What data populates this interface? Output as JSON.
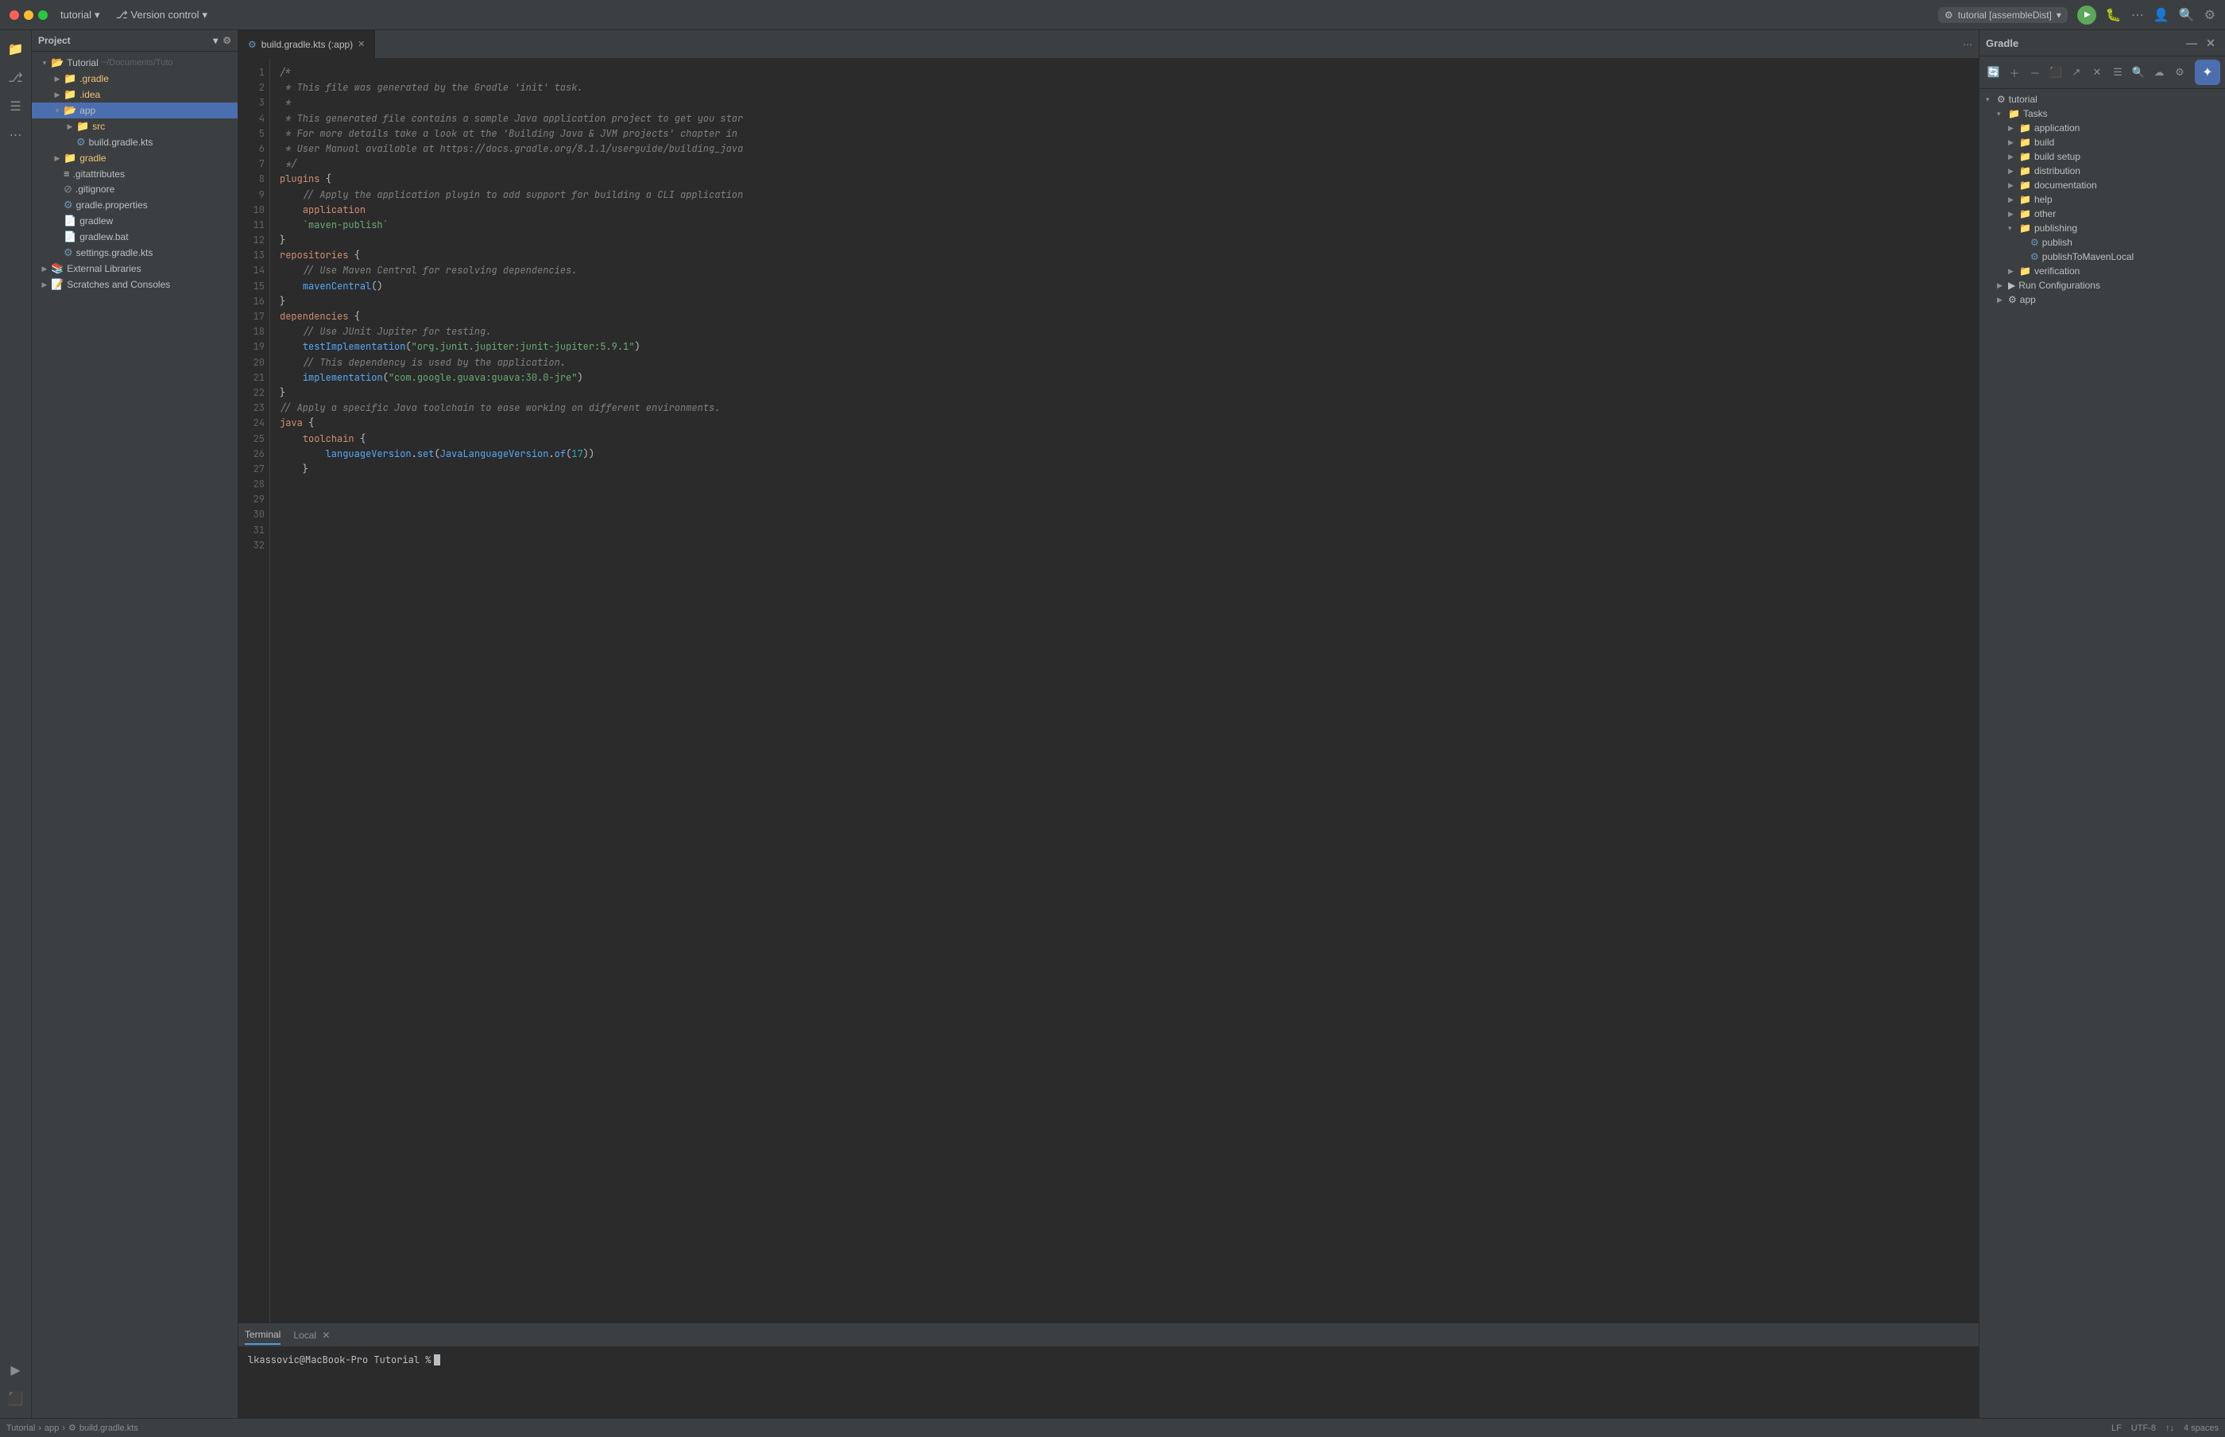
{
  "titlebar": {
    "project": "tutorial",
    "versionControl": "Version control",
    "runConfig": "tutorial [assembleDist]",
    "chevronDown": "▾"
  },
  "sidebar": {
    "title": "Project",
    "tree": [
      {
        "id": "tutorial",
        "label": "Tutorial",
        "sublabel": "~/Documents/Tuto",
        "type": "root",
        "indent": 0,
        "expanded": true,
        "arrow": "▾"
      },
      {
        "id": "gradle-dir",
        "label": ".gradle",
        "type": "folder",
        "indent": 1,
        "expanded": false,
        "arrow": "▶"
      },
      {
        "id": "idea-dir",
        "label": ".idea",
        "type": "folder",
        "indent": 1,
        "expanded": false,
        "arrow": "▶"
      },
      {
        "id": "app-dir",
        "label": "app",
        "type": "folder-selected",
        "indent": 1,
        "expanded": true,
        "arrow": "▾"
      },
      {
        "id": "src-dir",
        "label": "src",
        "type": "folder",
        "indent": 2,
        "expanded": false,
        "arrow": "▶"
      },
      {
        "id": "build-gradle",
        "label": "build.gradle.kts",
        "type": "gradle-file",
        "indent": 2,
        "expanded": false,
        "arrow": ""
      },
      {
        "id": "gradle-dir2",
        "label": "gradle",
        "type": "folder",
        "indent": 1,
        "expanded": false,
        "arrow": "▶"
      },
      {
        "id": "gitattributes",
        "label": ".gitattributes",
        "type": "file",
        "indent": 1,
        "expanded": false,
        "arrow": ""
      },
      {
        "id": "gitignore",
        "label": ".gitignore",
        "type": "file",
        "indent": 1,
        "expanded": false,
        "arrow": ""
      },
      {
        "id": "gradle-props",
        "label": "gradle.properties",
        "type": "settings-file",
        "indent": 1,
        "expanded": false,
        "arrow": ""
      },
      {
        "id": "gradlew",
        "label": "gradlew",
        "type": "file",
        "indent": 1,
        "expanded": false,
        "arrow": ""
      },
      {
        "id": "gradlew-bat",
        "label": "gradlew.bat",
        "type": "file",
        "indent": 1,
        "expanded": false,
        "arrow": ""
      },
      {
        "id": "settings-gradle",
        "label": "settings.gradle.kts",
        "type": "gradle-file",
        "indent": 1,
        "expanded": false,
        "arrow": ""
      },
      {
        "id": "external-libs",
        "label": "External Libraries",
        "type": "library",
        "indent": 0,
        "expanded": false,
        "arrow": "▶"
      },
      {
        "id": "scratches",
        "label": "Scratches and Consoles",
        "type": "scratch",
        "indent": 0,
        "expanded": false,
        "arrow": "▶"
      }
    ]
  },
  "editor": {
    "tab": {
      "icon": "⚙",
      "label": "build.gradle.kts (:app)",
      "closeable": true
    },
    "lines": [
      {
        "num": 1,
        "content": "/*",
        "type": "comment"
      },
      {
        "num": 2,
        "content": " * This file was generated by the Gradle 'init' task.",
        "type": "comment"
      },
      {
        "num": 3,
        "content": " *",
        "type": "comment"
      },
      {
        "num": 4,
        "content": " * This generated file contains a sample Java application project to get you star",
        "type": "comment"
      },
      {
        "num": 5,
        "content": " * For more details take a look at the 'Building Java & JVM projects' chapter in",
        "type": "comment"
      },
      {
        "num": 6,
        "content": " * User Manual available at https://docs.gradle.org/8.1.1/userguide/building_java",
        "type": "comment"
      },
      {
        "num": 7,
        "content": " */",
        "type": "comment"
      },
      {
        "num": 8,
        "content": "",
        "type": "empty"
      },
      {
        "num": 9,
        "content": "plugins {",
        "type": "code"
      },
      {
        "num": 10,
        "content": "    // Apply the application plugin to add support for building a CLI application",
        "type": "comment"
      },
      {
        "num": 11,
        "content": "    application",
        "type": "keyword"
      },
      {
        "num": 12,
        "content": "    `maven-publish`",
        "type": "backtick"
      },
      {
        "num": 13,
        "content": "}",
        "type": "code"
      },
      {
        "num": 14,
        "content": "",
        "type": "empty"
      },
      {
        "num": 15,
        "content": "repositories {",
        "type": "code"
      },
      {
        "num": 16,
        "content": "    // Use Maven Central for resolving dependencies.",
        "type": "comment"
      },
      {
        "num": 17,
        "content": "    mavenCentral()",
        "type": "code"
      },
      {
        "num": 18,
        "content": "}",
        "type": "code"
      },
      {
        "num": 19,
        "content": "",
        "type": "empty"
      },
      {
        "num": 20,
        "content": "dependencies {",
        "type": "code"
      },
      {
        "num": 21,
        "content": "    // Use JUnit Jupiter for testing.",
        "type": "comment"
      },
      {
        "num": 22,
        "content": "    testImplementation(\"org.junit.jupiter:junit-jupiter:5.9.1\")",
        "type": "code"
      },
      {
        "num": 23,
        "content": "",
        "type": "empty"
      },
      {
        "num": 24,
        "content": "    // This dependency is used by the application.",
        "type": "comment"
      },
      {
        "num": 25,
        "content": "    implementation(\"com.google.guava:guava:30.0-jre\")",
        "type": "code"
      },
      {
        "num": 26,
        "content": "}",
        "type": "code"
      },
      {
        "num": 27,
        "content": "",
        "type": "empty"
      },
      {
        "num": 28,
        "content": "// Apply a specific Java toolchain to ease working on different environments.",
        "type": "comment"
      },
      {
        "num": 29,
        "content": "java {",
        "type": "code"
      },
      {
        "num": 30,
        "content": "    toolchain {",
        "type": "code"
      },
      {
        "num": 31,
        "content": "        languageVersion.set(JavaLanguageVersion.of(17))",
        "type": "code"
      },
      {
        "num": 32,
        "content": "    }",
        "type": "code"
      }
    ]
  },
  "gradle": {
    "title": "Gradle",
    "tree": [
      {
        "id": "tutorial-root",
        "label": "tutorial",
        "type": "root",
        "expanded": true,
        "indent": 0,
        "arrow": "▾"
      },
      {
        "id": "tasks",
        "label": "Tasks",
        "type": "folder",
        "expanded": true,
        "indent": 1,
        "arrow": "▾"
      },
      {
        "id": "application",
        "label": "application",
        "type": "task-folder",
        "expanded": false,
        "indent": 2,
        "arrow": "▶"
      },
      {
        "id": "build",
        "label": "build",
        "type": "task-folder",
        "expanded": false,
        "indent": 2,
        "arrow": "▶"
      },
      {
        "id": "build-setup",
        "label": "build setup",
        "type": "task-folder",
        "expanded": false,
        "indent": 2,
        "arrow": "▶"
      },
      {
        "id": "distribution",
        "label": "distribution",
        "type": "task-folder",
        "expanded": false,
        "indent": 2,
        "arrow": "▶"
      },
      {
        "id": "documentation",
        "label": "documentation",
        "type": "task-folder",
        "expanded": false,
        "indent": 2,
        "arrow": "▶"
      },
      {
        "id": "help",
        "label": "help",
        "type": "task-folder",
        "expanded": false,
        "indent": 2,
        "arrow": "▶"
      },
      {
        "id": "other",
        "label": "other",
        "type": "task-folder",
        "expanded": false,
        "indent": 2,
        "arrow": "▶"
      },
      {
        "id": "publishing",
        "label": "publishing",
        "type": "task-folder",
        "expanded": true,
        "indent": 2,
        "arrow": "▾"
      },
      {
        "id": "publish",
        "label": "publish",
        "type": "task",
        "expanded": false,
        "indent": 3,
        "arrow": ""
      },
      {
        "id": "publishToMavenLocal",
        "label": "publishToMavenLocal",
        "type": "task",
        "expanded": false,
        "indent": 3,
        "arrow": ""
      },
      {
        "id": "verification",
        "label": "verification",
        "type": "task-folder",
        "expanded": false,
        "indent": 2,
        "arrow": "▶"
      },
      {
        "id": "run-configs",
        "label": "Run Configurations",
        "type": "run-configs",
        "expanded": false,
        "indent": 1,
        "arrow": "▶"
      },
      {
        "id": "app",
        "label": "app",
        "type": "gradle-project",
        "expanded": false,
        "indent": 1,
        "arrow": "▶"
      }
    ]
  },
  "terminal": {
    "tabs": [
      {
        "label": "Terminal",
        "active": true
      },
      {
        "label": "Local",
        "active": false
      }
    ],
    "prompt": "lkassovic@MacBook-Pro Tutorial %"
  },
  "statusbar": {
    "breadcrumb": [
      "Tutorial",
      "app",
      "build.gradle.kts"
    ],
    "lineEnding": "LF",
    "encoding": "UTF-8",
    "indent": "4 spaces"
  }
}
